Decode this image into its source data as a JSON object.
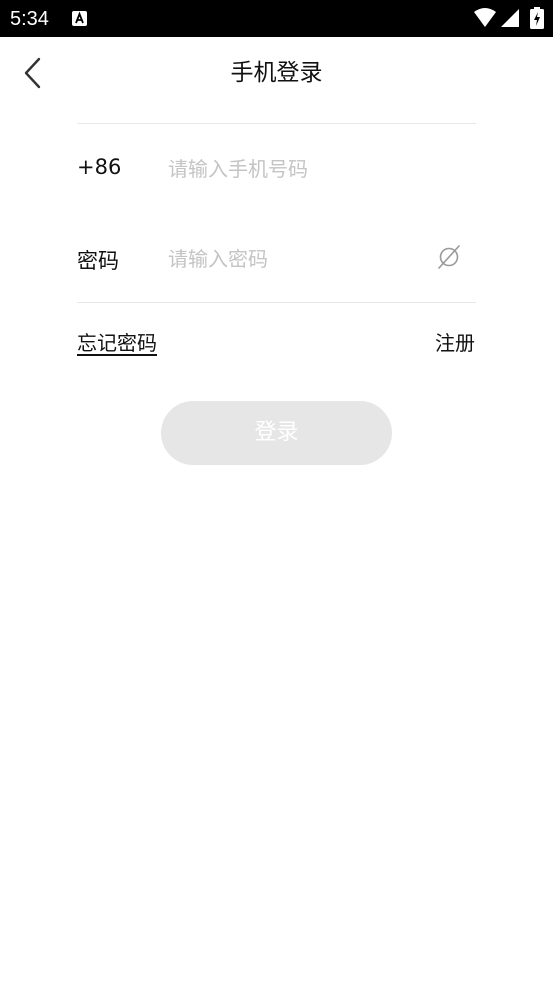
{
  "status_bar": {
    "time": "5:34",
    "notification_icon": "a-square-icon",
    "icons": [
      "wifi-icon",
      "signal-icon",
      "battery-charging-icon"
    ]
  },
  "header": {
    "title": "手机登录",
    "back_icon": "chevron-left-icon"
  },
  "form": {
    "phone": {
      "country_code": "+86",
      "value": "",
      "placeholder": "请输入手机号码"
    },
    "password": {
      "label": "密码",
      "value": "",
      "placeholder": "请输入密码",
      "visibility_icon": "eye-off-icon"
    }
  },
  "links": {
    "forgot_password": "忘记密码",
    "register": "注册"
  },
  "login_button": {
    "label": "登录",
    "enabled": false
  },
  "colors": {
    "status_bar_bg": "#000000",
    "background": "#ffffff",
    "text": "#111111",
    "placeholder": "#c4c4c4",
    "divider": "#e8e8e8",
    "button_disabled_bg": "#e6e6e6",
    "button_text": "#ffffff",
    "icon_gray": "#9a9a9a"
  }
}
